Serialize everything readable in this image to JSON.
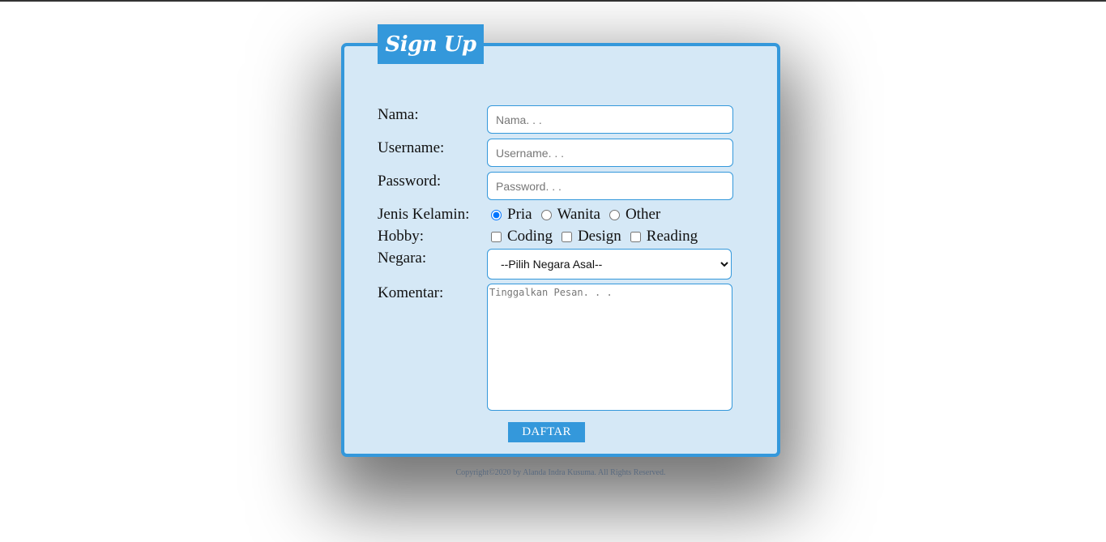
{
  "form": {
    "title": "Sign Up",
    "fields": {
      "nama": {
        "label": "Nama:",
        "placeholder": "Nama. . ."
      },
      "username": {
        "label": "Username:",
        "placeholder": "Username. . ."
      },
      "password": {
        "label": "Password:",
        "placeholder": "Password. . ."
      }
    },
    "gender": {
      "label": "Jenis Kelamin:",
      "options": [
        "Pria",
        "Wanita",
        "Other"
      ],
      "selected": "Pria"
    },
    "hobby": {
      "label": "Hobby:",
      "options": [
        "Coding",
        "Design",
        "Reading"
      ],
      "checked": []
    },
    "country": {
      "label": "Negara:",
      "selected": "--Pilih Negara Asal--"
    },
    "comment": {
      "label": "Komentar:",
      "placeholder": "Tinggalkan Pesan. . ."
    },
    "submit_label": "DAFTAR"
  },
  "footer": {
    "text": "Copyright©2020 by Alanda Indra Kusuma. All Rights Reserved."
  },
  "colors": {
    "accent": "#3498db",
    "card_background": "#d5e8f6",
    "footer_text": "#5a6b80"
  }
}
